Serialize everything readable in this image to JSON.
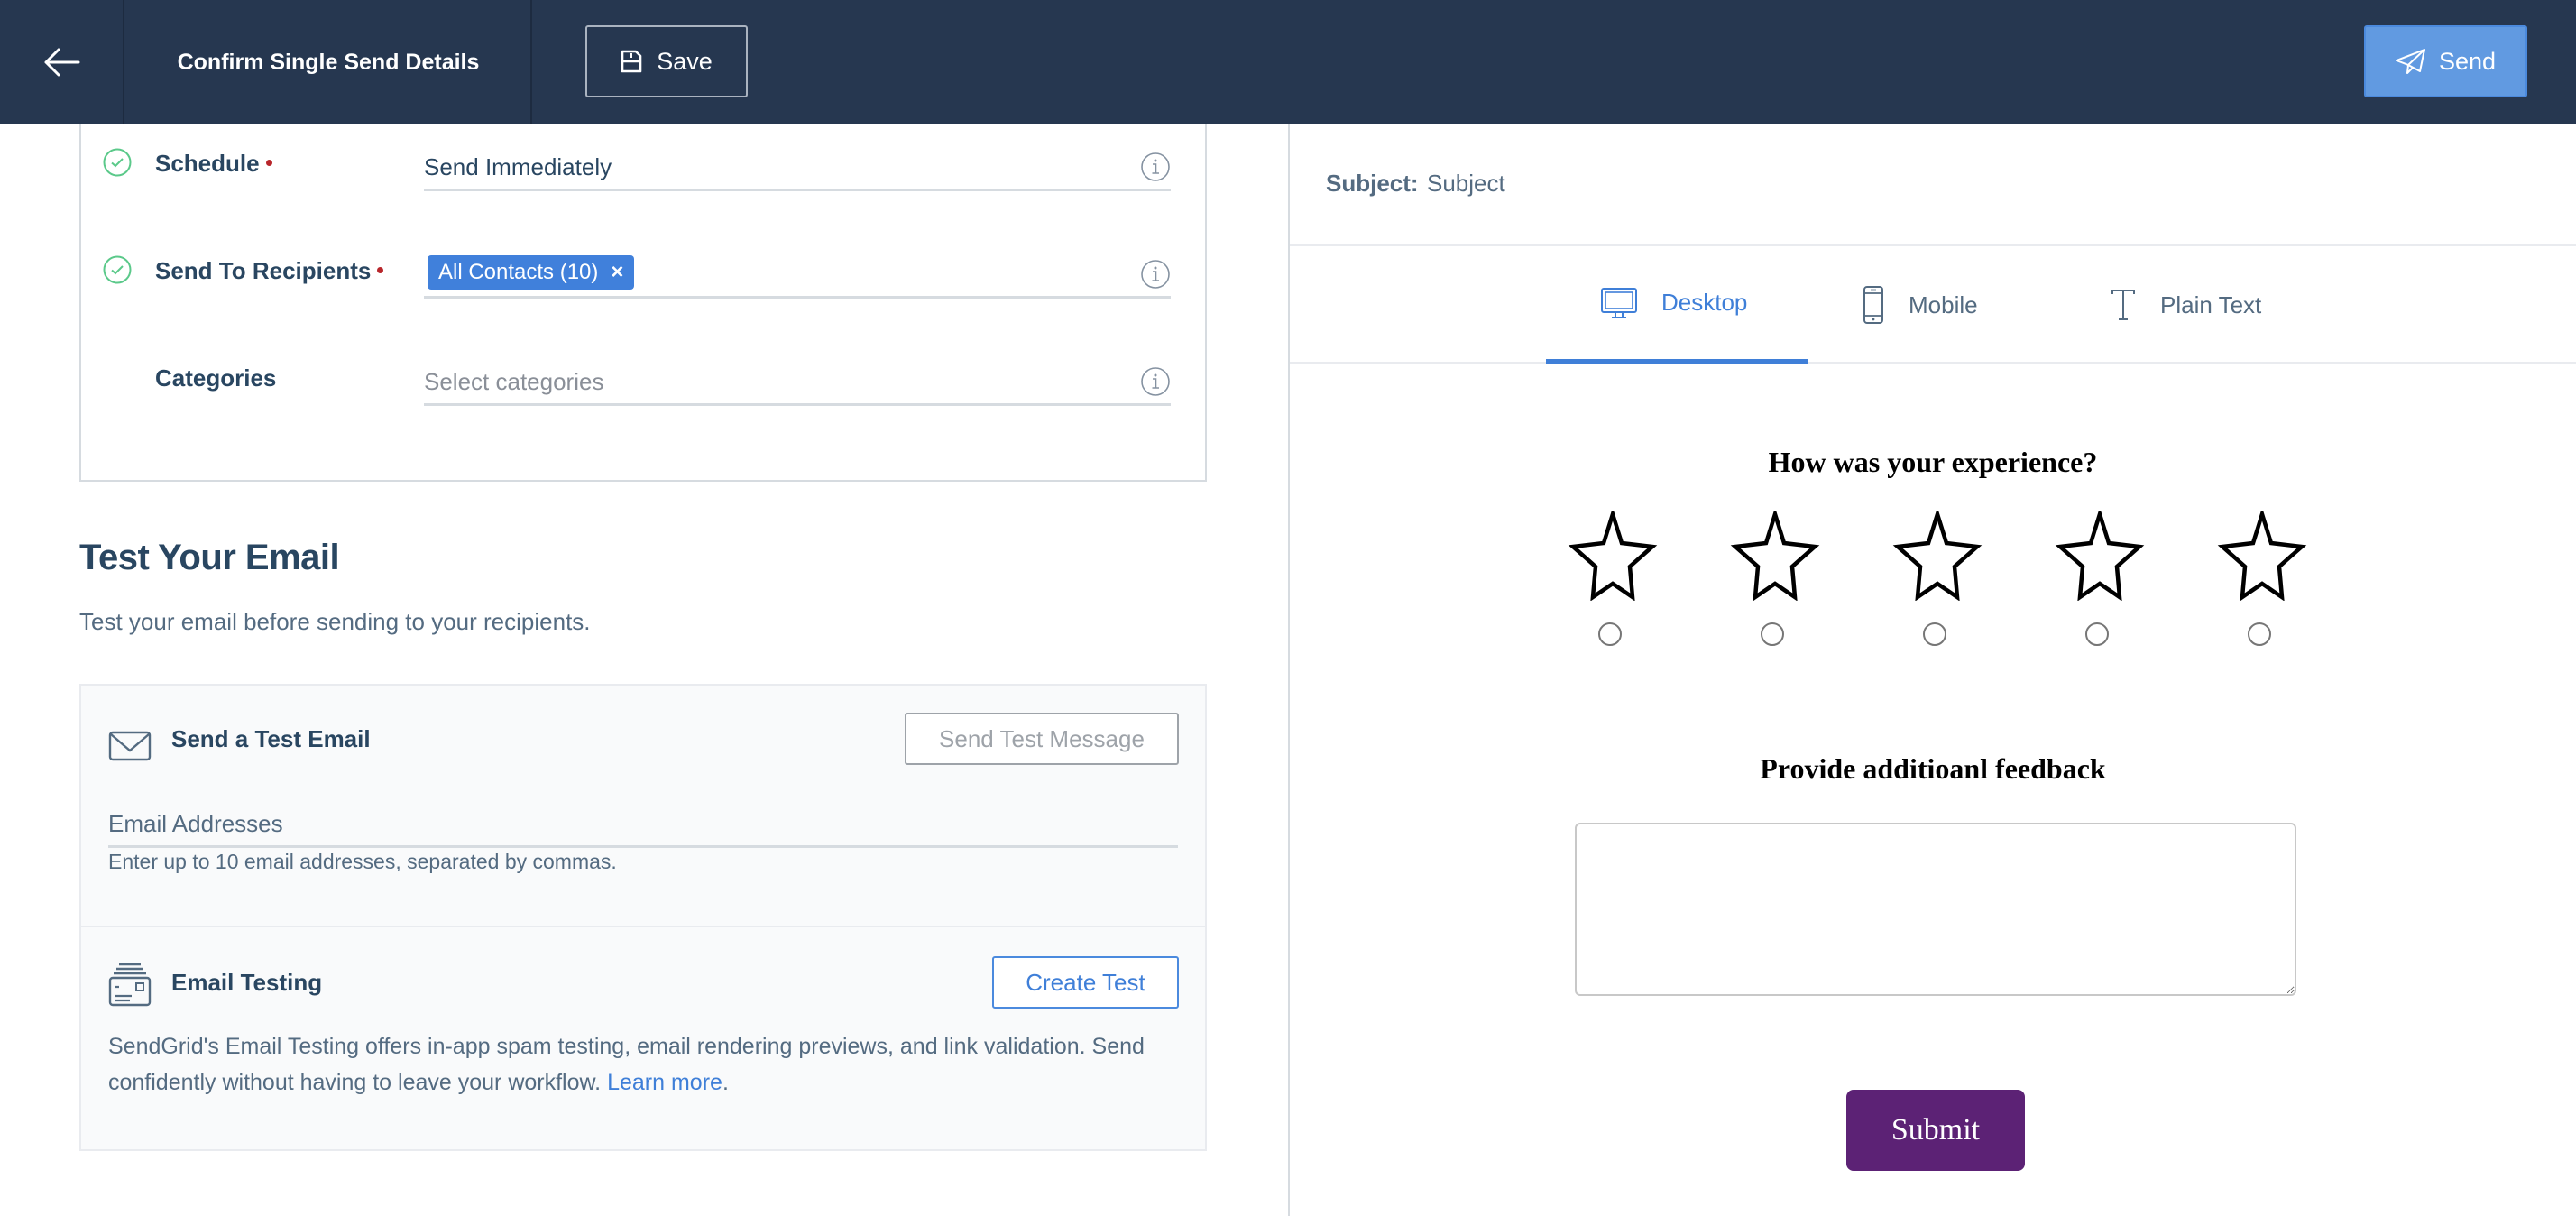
{
  "header": {
    "back_icon": "arrow-left-icon",
    "title": "Confirm Single Send Details",
    "save_label": "Save",
    "save_icon": "floppy-disk-icon",
    "send_label": "Send",
    "send_icon": "paper-plane-icon"
  },
  "details": {
    "fields": [
      {
        "label": "Schedule",
        "required": true,
        "completed": true,
        "value": "Send Immediately"
      },
      {
        "label": "Send To Recipients",
        "required": true,
        "completed": true,
        "chips": [
          "All Contacts (10)"
        ],
        "chip_remove": "×"
      },
      {
        "label": "Categories",
        "required": false,
        "completed": false,
        "placeholder": "Select categories"
      }
    ]
  },
  "test_section": {
    "title": "Test Your Email",
    "subtitle": "Test your email before sending to your recipients.",
    "send_test": {
      "icon": "envelope-icon",
      "title": "Send a Test Email",
      "button_label": "Send Test Message",
      "input_placeholder": "Email Addresses",
      "help_text": "Enter up to 10 email addresses, separated by commas."
    },
    "email_testing": {
      "icon": "email-testing-icon",
      "title": "Email Testing",
      "button_label": "Create Test",
      "description": "SendGrid's Email Testing offers in-app spam testing, email rendering previews, and link validation. Send confidently without having to leave your workflow.",
      "link_label": "Learn more",
      "link_suffix": "."
    }
  },
  "preview": {
    "subject_label": "Subject:",
    "subject_value": "Subject",
    "tabs": [
      {
        "label": "Desktop",
        "icon": "desktop-monitor-icon",
        "active": true
      },
      {
        "label": "Mobile",
        "icon": "mobile-phone-icon",
        "active": false
      },
      {
        "label": "Plain Text",
        "icon": "text-t-icon",
        "active": false
      }
    ],
    "content": {
      "question": "How was your experience?",
      "rating_max": 5,
      "rating_selected": 0,
      "feedback_title": "Provide additioanl feedback",
      "feedback_value": "",
      "submit_label": "Submit"
    }
  },
  "colors": {
    "header_bg": "#263750",
    "primary_blue": "#619ae1",
    "link_blue": "#3f7fd8",
    "success_green": "#5bc98a",
    "required_red": "#b8262b",
    "submit_purple": "#5c2275"
  }
}
